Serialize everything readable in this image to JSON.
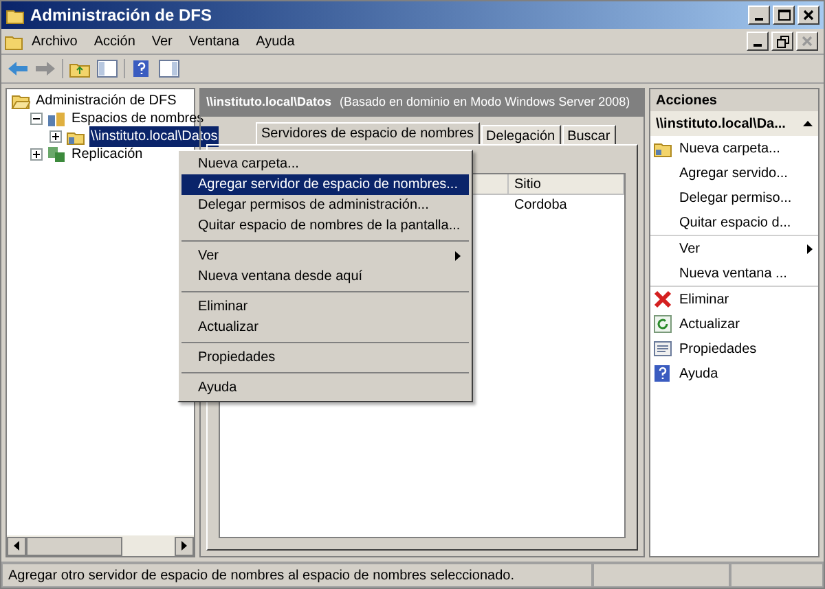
{
  "window": {
    "title": "Administración de DFS"
  },
  "menu_bar": [
    "Archivo",
    "Acción",
    "Ver",
    "Ventana",
    "Ayuda"
  ],
  "tree": [
    {
      "label": "Administración de DFS",
      "kind": "root",
      "expanded": true,
      "selected": false,
      "children": [
        {
          "label": "Espacios de nombres",
          "kind": "namespaces",
          "expanded": true,
          "selected": false,
          "children": [
            {
              "label": "\\\\instituto.local\\Datos",
              "kind": "namespace",
              "expanded": false,
              "selected": true
            }
          ]
        },
        {
          "label": "Replicación",
          "kind": "replication",
          "expanded": false,
          "selected": false
        }
      ]
    }
  ],
  "center": {
    "header": "\\\\instituto.local\\Datos",
    "subheader": "(Basado en dominio en Modo Windows Server 2008)",
    "tabs": [
      {
        "label": "Servidores de espacio de nombres",
        "selected": true
      },
      {
        "label": "Delegación",
        "selected": false
      },
      {
        "label": "Buscar",
        "selected": false
      }
    ],
    "table": {
      "columns": [
        "Sitio"
      ],
      "rows": [
        [
          "Cordoba"
        ]
      ]
    }
  },
  "context_menu": [
    [
      {
        "label": "Nueva carpeta...",
        "kind": "item",
        "selected": false
      },
      {
        "label": "Agregar servidor de espacio de nombres...",
        "kind": "item",
        "selected": true
      },
      {
        "label": "Delegar permisos de administración...",
        "kind": "item",
        "selected": false
      },
      {
        "label": "Quitar espacio de nombres de la pantalla...",
        "kind": "item",
        "selected": false
      }
    ],
    [
      {
        "label": "Ver",
        "kind": "submenu",
        "selected": false
      },
      {
        "label": "Nueva ventana desde aquí",
        "kind": "item",
        "selected": false
      }
    ],
    [
      {
        "label": "Eliminar",
        "kind": "item",
        "selected": false
      },
      {
        "label": "Actualizar",
        "kind": "item",
        "selected": false
      }
    ],
    [
      {
        "label": "Propiedades",
        "kind": "item",
        "selected": false
      }
    ],
    [
      {
        "label": "Ayuda",
        "kind": "item",
        "selected": false
      }
    ]
  ],
  "actions": {
    "title": "Acciones",
    "section": "\\\\instituto.local\\Da...",
    "expanded": true,
    "groups": [
      [
        {
          "label": "Nueva carpeta...",
          "kind": "new"
        },
        {
          "label": "Agregar servido...",
          "kind": "plain"
        },
        {
          "label": "Delegar permiso...",
          "kind": "plain"
        },
        {
          "label": "Quitar espacio d...",
          "kind": "plain"
        }
      ],
      [
        {
          "label": "Ver",
          "kind": "submenu"
        },
        {
          "label": "Nueva ventana ...",
          "kind": "plain"
        }
      ],
      [
        {
          "label": "Eliminar",
          "kind": "delete"
        },
        {
          "label": "Actualizar",
          "kind": "refresh"
        },
        {
          "label": "Propiedades",
          "kind": "properties"
        },
        {
          "label": "Ayuda",
          "kind": "help"
        }
      ]
    ]
  },
  "status_bar": "Agregar otro servidor de espacio de nombres al espacio de nombres seleccionado."
}
